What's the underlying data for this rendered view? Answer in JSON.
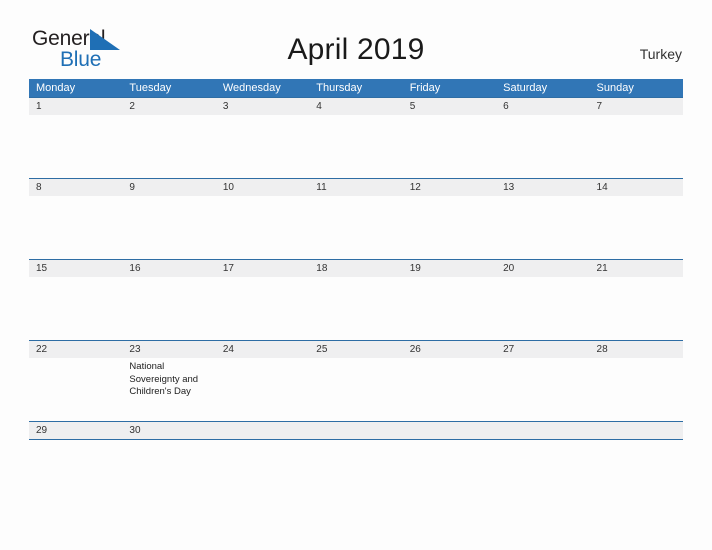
{
  "logo": {
    "word1": "General",
    "word2": "Blue",
    "triangle_icon": "triangle-icon",
    "blue": "#1f6fb5"
  },
  "header": {
    "title": "April 2019",
    "country": "Turkey"
  },
  "theme": {
    "header_blue": "#3176b6",
    "rule_blue": "#2e6da4",
    "band_gray": "#efeff0",
    "page_bg": "#fdfdfd"
  },
  "calendar": {
    "weekdays": [
      "Monday",
      "Tuesday",
      "Wednesday",
      "Thursday",
      "Friday",
      "Saturday",
      "Sunday"
    ],
    "weeks": [
      [
        {
          "day": "1",
          "events": []
        },
        {
          "day": "2",
          "events": []
        },
        {
          "day": "3",
          "events": []
        },
        {
          "day": "4",
          "events": []
        },
        {
          "day": "5",
          "events": []
        },
        {
          "day": "6",
          "events": []
        },
        {
          "day": "7",
          "events": []
        }
      ],
      [
        {
          "day": "8",
          "events": []
        },
        {
          "day": "9",
          "events": []
        },
        {
          "day": "10",
          "events": []
        },
        {
          "day": "11",
          "events": []
        },
        {
          "day": "12",
          "events": []
        },
        {
          "day": "13",
          "events": []
        },
        {
          "day": "14",
          "events": []
        }
      ],
      [
        {
          "day": "15",
          "events": []
        },
        {
          "day": "16",
          "events": []
        },
        {
          "day": "17",
          "events": []
        },
        {
          "day": "18",
          "events": []
        },
        {
          "day": "19",
          "events": []
        },
        {
          "day": "20",
          "events": []
        },
        {
          "day": "21",
          "events": []
        }
      ],
      [
        {
          "day": "22",
          "events": []
        },
        {
          "day": "23",
          "events": [
            "National Sovereignty and Children's Day"
          ]
        },
        {
          "day": "24",
          "events": []
        },
        {
          "day": "25",
          "events": []
        },
        {
          "day": "26",
          "events": []
        },
        {
          "day": "27",
          "events": []
        },
        {
          "day": "28",
          "events": []
        }
      ],
      [
        {
          "day": "29",
          "events": []
        },
        {
          "day": "30",
          "events": []
        },
        {
          "day": "",
          "events": []
        },
        {
          "day": "",
          "events": []
        },
        {
          "day": "",
          "events": []
        },
        {
          "day": "",
          "events": []
        },
        {
          "day": "",
          "events": []
        }
      ]
    ]
  }
}
